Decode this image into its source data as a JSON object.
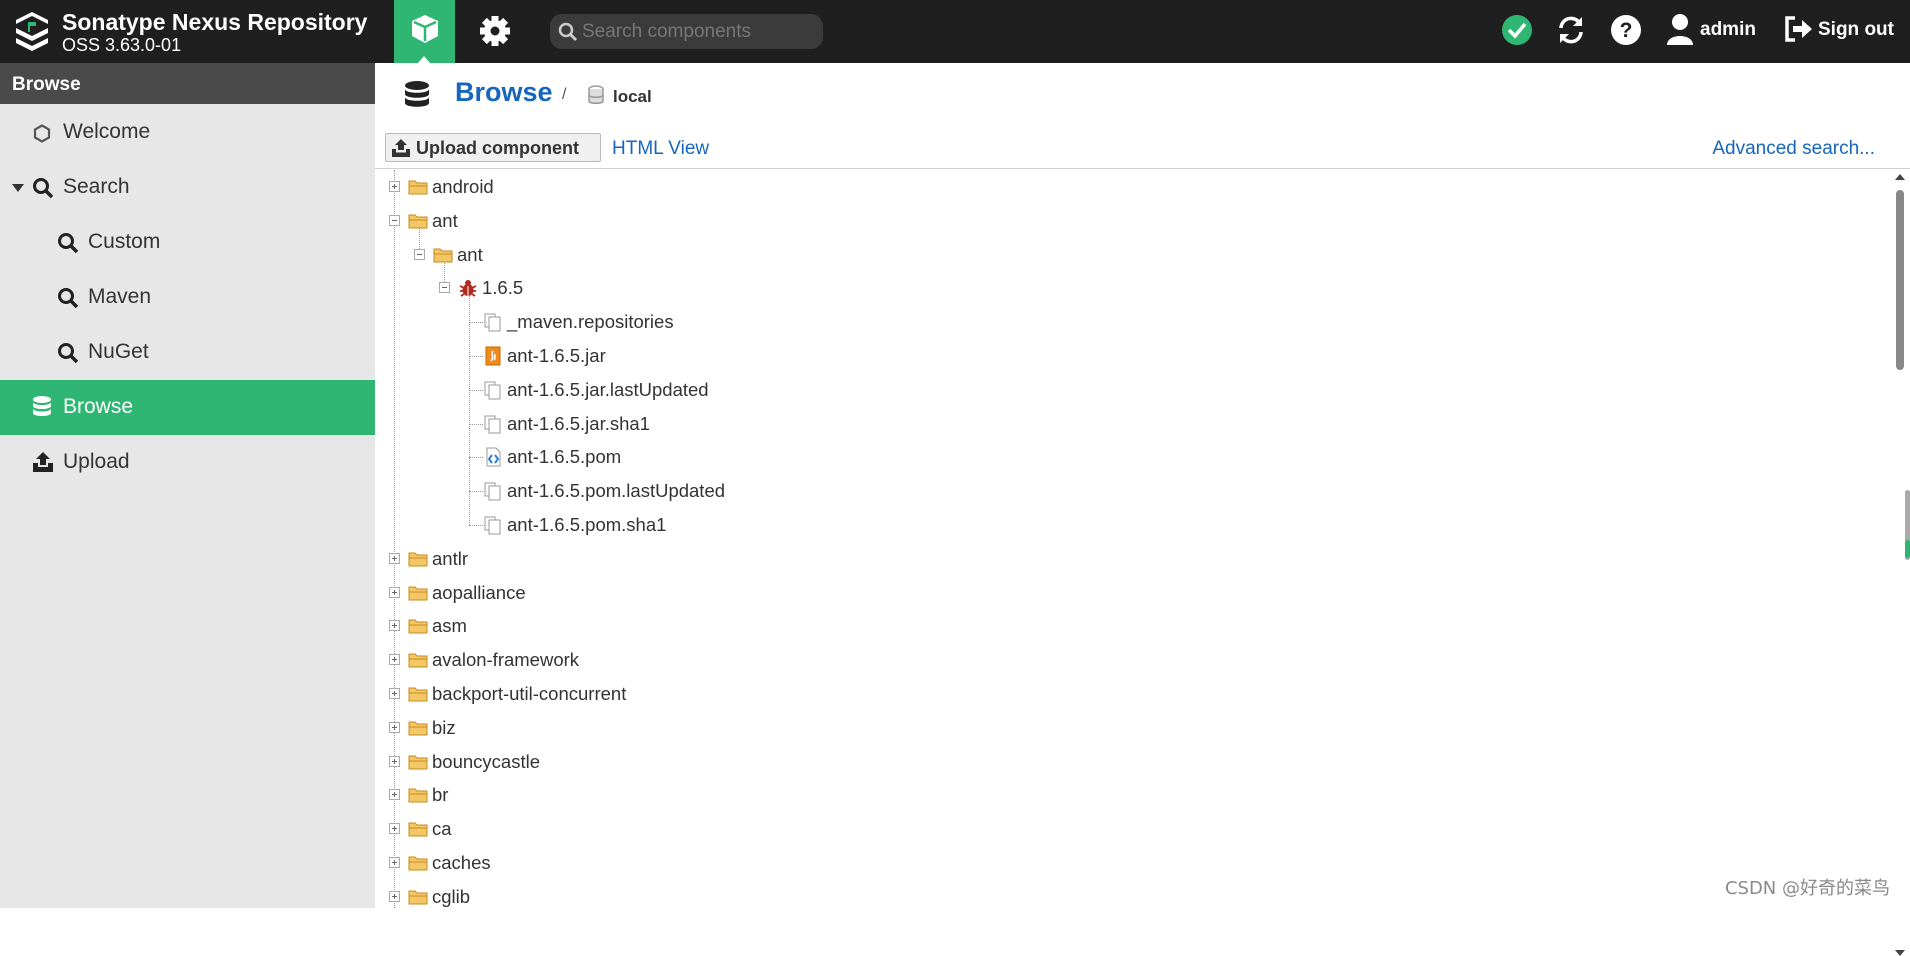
{
  "header": {
    "brand_title": "Sonatype Nexus Repository",
    "brand_version": "OSS 3.63.0-01",
    "search_placeholder": "Search components",
    "user": "admin",
    "signout": "Sign out",
    "status_color": "#2eb672"
  },
  "sidebar": {
    "title": "Browse",
    "items": [
      {
        "label": "Welcome",
        "icon": "hexagon-icon"
      },
      {
        "label": "Search",
        "icon": "search-icon"
      },
      {
        "label": "Custom",
        "icon": "search-icon"
      },
      {
        "label": "Maven",
        "icon": "search-icon"
      },
      {
        "label": "NuGet",
        "icon": "search-icon"
      },
      {
        "label": "Browse",
        "icon": "database-icon",
        "active": true
      },
      {
        "label": "Upload",
        "icon": "upload-icon"
      }
    ]
  },
  "main": {
    "breadcrumb_title": "Browse",
    "breadcrumb_separator": "/",
    "repository": "local",
    "upload_button": "Upload component",
    "html_view": "HTML View",
    "advanced_search": "Advanced search..."
  },
  "tree": [
    {
      "label": "android",
      "level": 0,
      "type": "folder",
      "state": "collapsed"
    },
    {
      "label": "ant",
      "level": 0,
      "type": "folder",
      "state": "expanded"
    },
    {
      "label": "ant",
      "level": 1,
      "type": "folder",
      "state": "expanded"
    },
    {
      "label": "1.6.5",
      "level": 2,
      "type": "component",
      "state": "expanded"
    },
    {
      "label": "_maven.repositories",
      "level": 3,
      "type": "file"
    },
    {
      "label": "ant-1.6.5.jar",
      "level": 3,
      "type": "jar"
    },
    {
      "label": "ant-1.6.5.jar.lastUpdated",
      "level": 3,
      "type": "file"
    },
    {
      "label": "ant-1.6.5.jar.sha1",
      "level": 3,
      "type": "file"
    },
    {
      "label": "ant-1.6.5.pom",
      "level": 3,
      "type": "pom"
    },
    {
      "label": "ant-1.6.5.pom.lastUpdated",
      "level": 3,
      "type": "file"
    },
    {
      "label": "ant-1.6.5.pom.sha1",
      "level": 3,
      "type": "file"
    },
    {
      "label": "antlr",
      "level": 0,
      "type": "folder",
      "state": "collapsed"
    },
    {
      "label": "aopalliance",
      "level": 0,
      "type": "folder",
      "state": "collapsed"
    },
    {
      "label": "asm",
      "level": 0,
      "type": "folder",
      "state": "collapsed"
    },
    {
      "label": "avalon-framework",
      "level": 0,
      "type": "folder",
      "state": "collapsed"
    },
    {
      "label": "backport-util-concurrent",
      "level": 0,
      "type": "folder",
      "state": "collapsed"
    },
    {
      "label": "biz",
      "level": 0,
      "type": "folder",
      "state": "collapsed"
    },
    {
      "label": "bouncycastle",
      "level": 0,
      "type": "folder",
      "state": "collapsed"
    },
    {
      "label": "br",
      "level": 0,
      "type": "folder",
      "state": "collapsed"
    },
    {
      "label": "ca",
      "level": 0,
      "type": "folder",
      "state": "collapsed"
    },
    {
      "label": "caches",
      "level": 0,
      "type": "folder",
      "state": "collapsed"
    },
    {
      "label": "cglib",
      "level": 0,
      "type": "folder",
      "state": "collapsed"
    }
  ],
  "watermark": "CSDN @好奇的菜鸟",
  "colors": {
    "accent": "#2eb672",
    "link": "#1766bd",
    "header_bg": "#1f1f1f",
    "folder": "#e8a93a",
    "component": "#b02a1e"
  }
}
